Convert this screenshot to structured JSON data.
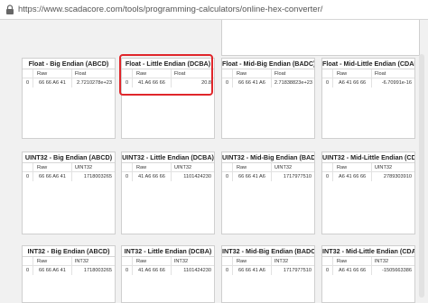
{
  "browser": {
    "url": "https://www.scadacore.com/tools/programming-calculators/online-hex-converter/"
  },
  "sections": [
    {
      "panels": [
        {
          "title": "Float - Big Endian (ABCD)",
          "col_raw": "Raw",
          "col_val": "Float",
          "index": "0",
          "raw": "66 66 A6 41",
          "value": "2.7210278e+23"
        },
        {
          "title": "Float - Little Endian (DCBA)",
          "col_raw": "Raw",
          "col_val": "Float",
          "index": "0",
          "raw": "41 A6 66 66",
          "value": "20.8"
        },
        {
          "title": "Float - Mid-Big Endian (BADC)",
          "col_raw": "Raw",
          "col_val": "Float",
          "index": "0",
          "raw": "66 66 41 A6",
          "value": "2.71838823e+23"
        },
        {
          "title": "Float - Mid-Little Endian (CDAB)",
          "col_raw": "Raw",
          "col_val": "Float",
          "index": "0",
          "raw": "A6 41 66 66",
          "value": "-6.70991e-16"
        }
      ]
    },
    {
      "panels": [
        {
          "title": "UINT32 - Big Endian (ABCD)",
          "col_raw": "Raw",
          "col_val": "UINT32",
          "index": "0",
          "raw": "66 66 A6 41",
          "value": "1718003265"
        },
        {
          "title": "UINT32 - Little Endian (DCBA)",
          "col_raw": "Raw",
          "col_val": "UINT32",
          "index": "0",
          "raw": "41 A6 66 66",
          "value": "1101424230"
        },
        {
          "title": "UINT32 - Mid-Big Endian (BADC)",
          "col_raw": "Raw",
          "col_val": "UINT32",
          "index": "0",
          "raw": "66 66 41 A6",
          "value": "1717977510"
        },
        {
          "title": "UINT32 - Mid-Little Endian (CDAB)",
          "col_raw": "Raw",
          "col_val": "UINT32",
          "index": "0",
          "raw": "A6 41 66 66",
          "value": "2789303910"
        }
      ]
    },
    {
      "panels": [
        {
          "title": "INT32 - Big Endian (ABCD)",
          "col_raw": "Raw",
          "col_val": "INT32",
          "index": "0",
          "raw": "66 66 A6 41",
          "value": "1718003265"
        },
        {
          "title": "INT32 - Little Endian (DCBA)",
          "col_raw": "Raw",
          "col_val": "INT32",
          "index": "0",
          "raw": "41 A6 66 66",
          "value": "1101424230"
        },
        {
          "title": "INT32 - Mid-Big Endian (BADC)",
          "col_raw": "Raw",
          "col_val": "INT32",
          "index": "0",
          "raw": "66 66 41 A6",
          "value": "1717977510"
        },
        {
          "title": "INT32 - Mid-Little Endian (CDAB)",
          "col_raw": "Raw",
          "col_val": "INT32",
          "index": "0",
          "raw": "A6 41 66 66",
          "value": "-1505663386"
        }
      ]
    }
  ],
  "highlight_color": "#e0262b",
  "icons": {
    "lock": "lock-icon"
  }
}
